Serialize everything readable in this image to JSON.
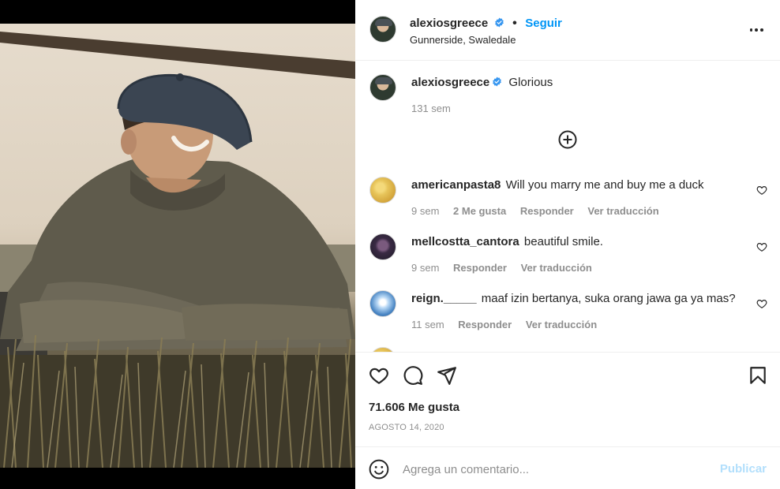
{
  "post": {
    "username": "alexiosgreece",
    "follow_label": "Seguir",
    "separator": "•",
    "location": "Gunnerside, Swaledale",
    "caption": "Glorious",
    "caption_age": "131 sem"
  },
  "comments": [
    {
      "username": "americanpasta8",
      "text": "Will you marry me and buy me a duck",
      "age": "9 sem",
      "likes": "2 Me gusta",
      "reply": "Responder",
      "translate": "Ver traducción"
    },
    {
      "username": "mellcostta_cantora",
      "text": "beautiful smile.",
      "age": "9 sem",
      "reply": "Responder",
      "translate": "Ver traducción"
    },
    {
      "username": "reign._____",
      "text": "maaf izin bertanya, suka orang jawa ga ya mas?",
      "age": "11 sem",
      "reply": "Responder",
      "translate": "Ver traducción"
    }
  ],
  "stats": {
    "likes": "71.606 Me gusta",
    "date": "AGOSTO 14, 2020"
  },
  "add_comment": {
    "placeholder": "Agrega un comentario...",
    "publish_label": "Publicar"
  },
  "icons": {
    "verified": "verified-badge-icon",
    "more": "more-options-icon",
    "load_more": "plus-circle-icon",
    "like": "heart-icon",
    "comment": "comment-bubble-icon",
    "share": "paper-plane-icon",
    "save": "bookmark-icon",
    "emoji": "smiley-icon"
  },
  "colors": {
    "accent": "#0095f6",
    "verified": "#3897f0",
    "publish_disabled": "#b2dffc",
    "muted_text": "#8e8e8e"
  }
}
